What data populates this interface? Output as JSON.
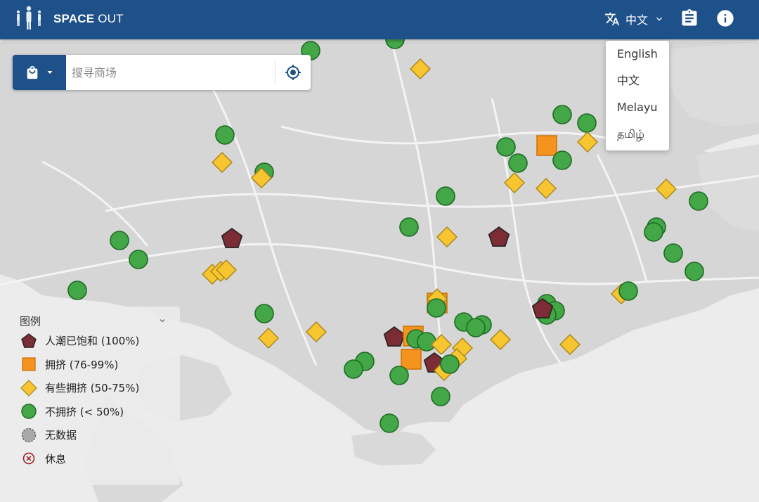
{
  "app": {
    "brand_bold": "SPACE",
    "brand_thin": " OUT"
  },
  "header": {
    "lang_current": "中文",
    "icons": [
      "translate-icon",
      "chevron-down-icon",
      "clipboard-icon",
      "info-icon"
    ]
  },
  "search": {
    "placeholder": "搜寻商场"
  },
  "lang_menu": {
    "items": [
      "English",
      "中文",
      "Melayu",
      "தமிழ்"
    ]
  },
  "legend": {
    "title": "图例",
    "items": [
      {
        "label": "人潮已饱和 (100%)",
        "symbol": "pentagon",
        "color": "#7b2c34"
      },
      {
        "label": "拥挤 (76-99%)",
        "symbol": "square",
        "color": "#f5931f"
      },
      {
        "label": "有些拥挤 (50-75%)",
        "symbol": "diamond",
        "color": "#f7c52f"
      },
      {
        "label": "不拥挤 (< 50%)",
        "symbol": "circle",
        "color": "#43a647"
      },
      {
        "label": "无数据",
        "symbol": "circle-dashed",
        "color": "#a9a9a9"
      },
      {
        "label": "休息",
        "symbol": "x-circle",
        "color": "#a0282c"
      }
    ]
  },
  "colors": {
    "header": "#1e5089",
    "full": "#7b2c34",
    "crowded": "#f5931f",
    "some": "#f7c52f",
    "clear": "#43a647"
  }
}
